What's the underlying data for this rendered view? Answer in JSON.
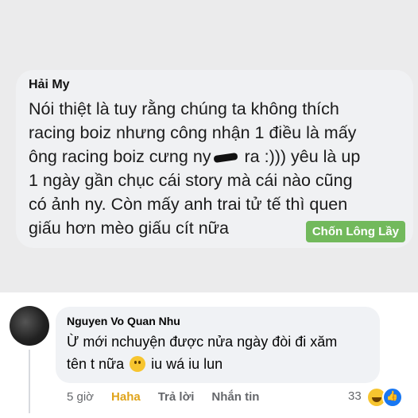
{
  "post": {
    "author": "Hải My",
    "text_part1": "Nói thiệt là tuy rằng chúng ta không thích\nracing boiz nhưng công nhận 1 điều là mấy\nông racing boiz cưng ny",
    "text_part2": " ra :))) yêu là up\n1 ngày gần chục cái story mà cái nào cũng\ncó ảnh ny. Còn mấy anh trai tử tế thì quen\ngiấu hơn mèo giấu cít nữa",
    "watermark": "Chốn Lông Lầy"
  },
  "comment": {
    "author": "Nguyen Vo Quan Nhu",
    "text_part1": "Ừ mới nchuyện được nửa ngày đòi đi xăm\ntên t nữa",
    "text_part2": "iu wá iu lun",
    "emoji": "slightly-smiling-face",
    "actions": {
      "time": "5 giờ",
      "reaction": "Haha",
      "reply": "Trả lời",
      "message": "Nhắn tin"
    },
    "reaction_count": "33",
    "reaction_icons": [
      "haha-icon",
      "like-icon"
    ]
  },
  "colors": {
    "watermark_bg": "#72b95c",
    "haha_text": "#e0a41b",
    "bubble_bg": "#f0f2f5"
  }
}
